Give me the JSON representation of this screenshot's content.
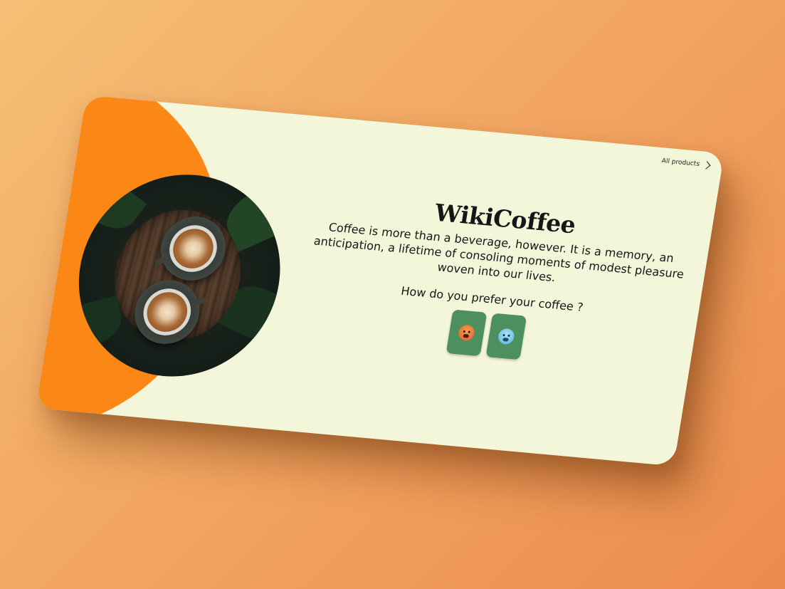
{
  "nav": {
    "all_products_label": "All products"
  },
  "hero": {
    "title": "WikiCoffee",
    "description": "Coffee is more than a beverage, however. It is a memory, an anticipation, a lifetime of consoling moments of modest pleasure woven into our lives.",
    "question": "How do you prefer your coffee ?"
  },
  "choices": [
    {
      "name": "hot-face-icon"
    },
    {
      "name": "cold-face-icon"
    }
  ],
  "colors": {
    "background_gradient": [
      "#f5bf76",
      "#ec8c4f"
    ],
    "card": "#f4f6da",
    "accent_orange": "#fb8717",
    "choice_green": "#4e8f5f"
  }
}
